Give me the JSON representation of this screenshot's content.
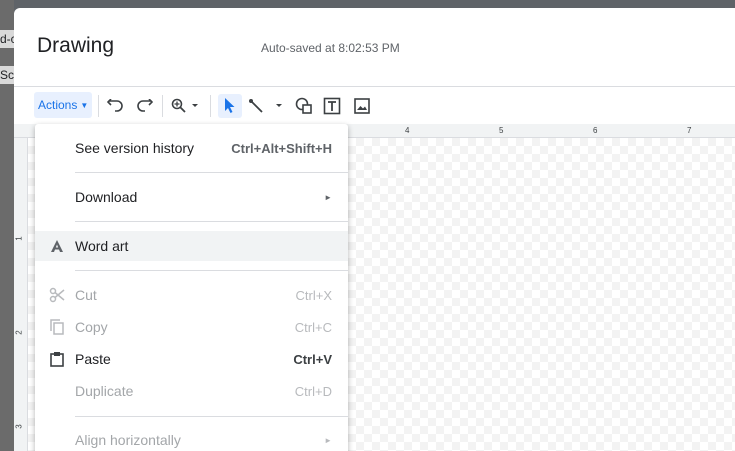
{
  "backdrop": {
    "fragment_1": "d-c",
    "fragment_2": "Sc"
  },
  "dialog": {
    "title": "Drawing",
    "autosave": "Auto-saved at 8:02:53 PM"
  },
  "toolbar": {
    "actions_label": "Actions",
    "icons": [
      "undo-icon",
      "redo-icon",
      "zoom-icon",
      "select-arrow-icon",
      "line-icon",
      "shape-icon",
      "text-box-icon",
      "image-icon"
    ]
  },
  "ruler": {
    "top": [
      "4",
      "5",
      "6",
      "7"
    ],
    "left": [
      "1",
      "2",
      "3"
    ]
  },
  "menu": {
    "items": [
      {
        "label": "See version history",
        "shortcut": "Ctrl+Alt+Shift+H",
        "enabled": true
      },
      {
        "label": "Download",
        "submenu": true,
        "enabled": true
      },
      {
        "label": "Word art",
        "icon": "word-art-icon",
        "enabled": true
      },
      {
        "label": "Cut",
        "shortcut": "Ctrl+X",
        "icon": "scissors-icon",
        "enabled": false
      },
      {
        "label": "Copy",
        "shortcut": "Ctrl+C",
        "icon": "copy-icon",
        "enabled": false
      },
      {
        "label": "Paste",
        "shortcut": "Ctrl+V",
        "icon": "clipboard-icon",
        "enabled": true
      },
      {
        "label": "Duplicate",
        "shortcut": "Ctrl+D",
        "enabled": false
      },
      {
        "label": "Align horizontally",
        "submenu": true,
        "enabled": false
      }
    ]
  },
  "colors": {
    "accent": "#1a73e8",
    "menu_hover": "#f1f3f4",
    "disabled_text": "#a3a6a9"
  }
}
